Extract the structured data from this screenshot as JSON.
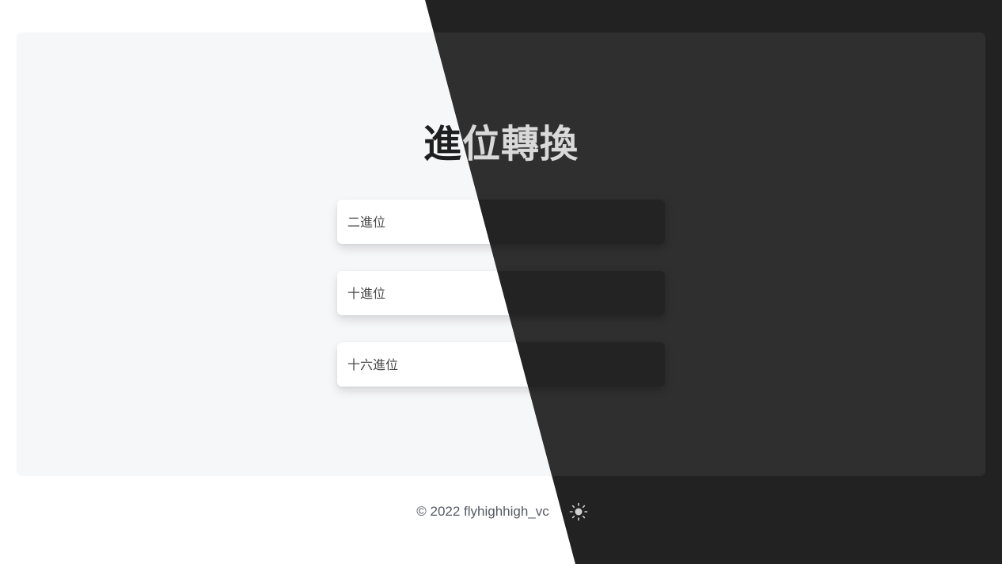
{
  "page": {
    "title": "進位轉換"
  },
  "fields": {
    "binary_placeholder": "二進位",
    "binary_value": "",
    "decimal_placeholder": "十進位",
    "decimal_value": "",
    "hex_placeholder": "十六進位",
    "hex_value": ""
  },
  "footer": {
    "copyright": "© 2022 flyhighhigh_vc",
    "theme_toggle_icon": "sun-icon"
  },
  "colors": {
    "light_background": "#ffffff",
    "light_card": "#f6f7f9",
    "dark_background": "#222222",
    "dark_card": "#2f2f2f"
  }
}
